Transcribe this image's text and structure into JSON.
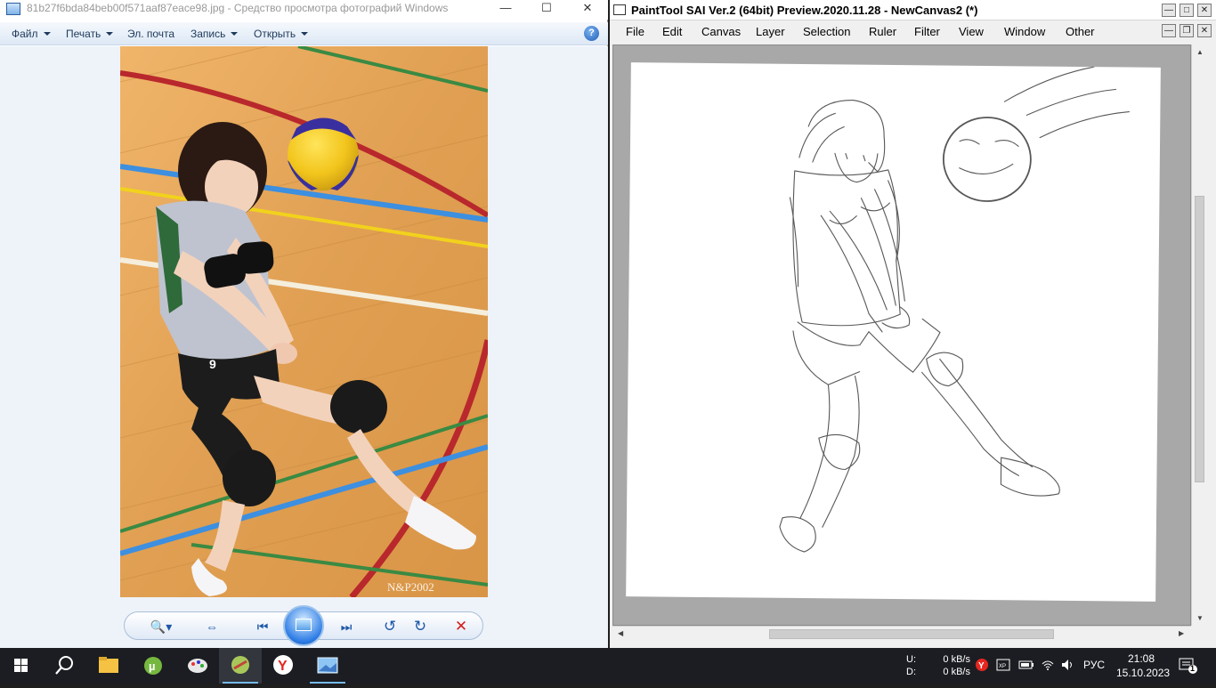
{
  "viewer": {
    "title": "81b27f6bda84beb00f571aaf87eace98.jpg - Средство просмотра фотографий Windows",
    "menu": [
      "Файл",
      "Печать",
      "Эл. почта",
      "Запись",
      "Открыть"
    ],
    "help_symbol": "?",
    "caption_buttons": [
      "—",
      "☐",
      "✕"
    ],
    "photo_watermark": "N&P2002",
    "photo_jersey_number": "9",
    "controls": {
      "zoom": "🔍▾",
      "fit": "⇔",
      "prev": "⏮",
      "next": "⏭",
      "rotate_left": "↺",
      "rotate_right": "↻",
      "delete": "✕"
    }
  },
  "sai": {
    "title": "PaintTool SAI Ver.2 (64bit) Preview.2020.11.28 - NewCanvas2 (*)",
    "menu": [
      "File",
      "Edit",
      "Canvas",
      "Layer",
      "Selection",
      "Ruler",
      "Filter",
      "View",
      "Window",
      "Other"
    ],
    "caption_buttons": [
      "—",
      "□",
      "✕"
    ],
    "mdi_buttons": [
      "—",
      "❐",
      "✕"
    ]
  },
  "taskbar": {
    "net_labels": [
      "U:",
      "D:"
    ],
    "net_values": [
      "0 kB/s",
      "0 kB/s"
    ],
    "lang": "РУС",
    "time": "21:08",
    "date": "15.10.2023",
    "notification_count": "1"
  },
  "colors": {
    "accent": "#76b9ed",
    "sai_canvas_bg": "#a8a8a8",
    "court_wood": "#e3a457",
    "court_red_line": "#b8282c",
    "court_blue_line": "#3d8fe0",
    "court_green_line": "#3a8a43"
  }
}
